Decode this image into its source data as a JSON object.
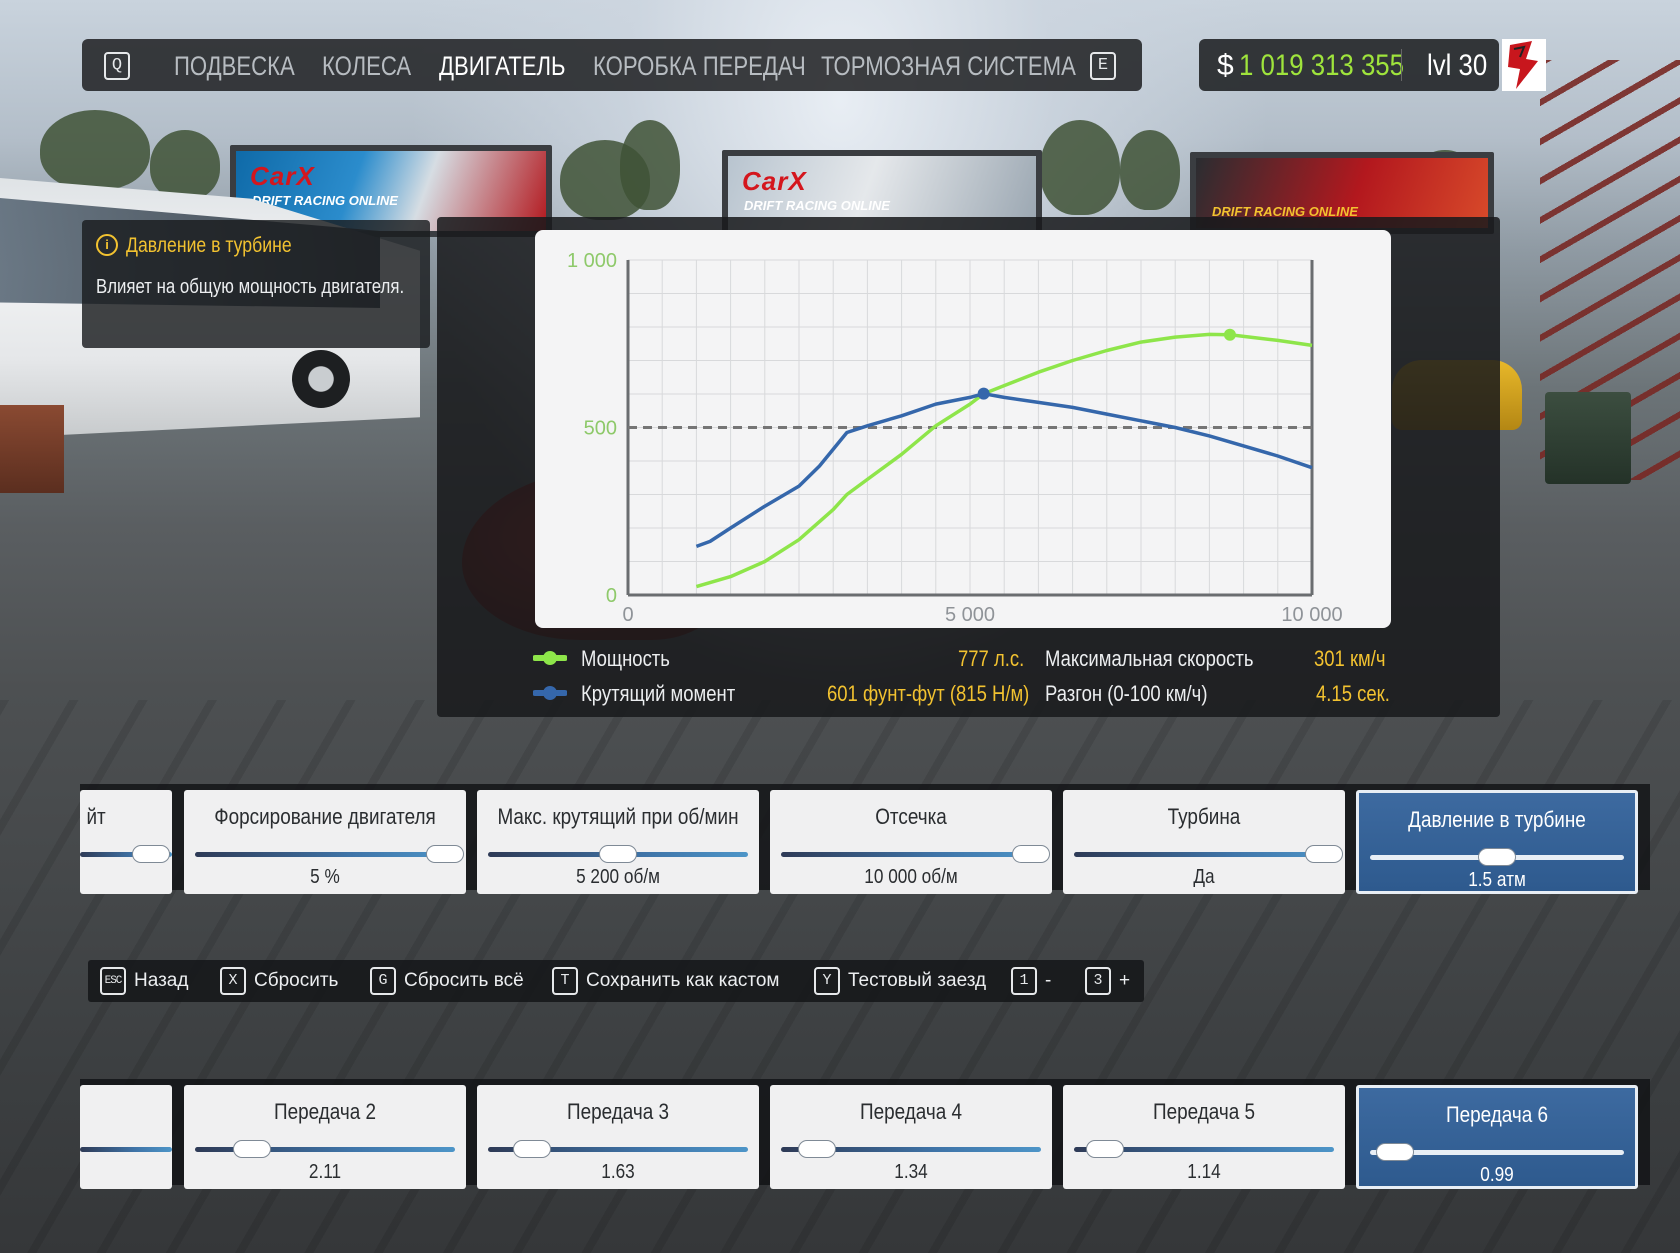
{
  "tabs": {
    "prev_key": "Q",
    "next_key": "E",
    "items": [
      {
        "label": "ПОДВЕСКА",
        "active": false
      },
      {
        "label": "КОЛЕСА",
        "active": false
      },
      {
        "label": "ДВИГАТЕЛЬ",
        "active": true
      },
      {
        "label": "КОРОБКА ПЕРЕДАЧ",
        "active": false
      },
      {
        "label": "ТОРМОЗНАЯ СИСТЕМА",
        "active": false
      }
    ]
  },
  "player": {
    "currency": "$",
    "money": "1 019 313 355",
    "level": "lvl 30"
  },
  "info": {
    "icon": "info-icon",
    "title": "Давление в турбине",
    "text": "Влияет на общую мощность двигателя."
  },
  "chart_data": {
    "type": "line",
    "x_ticks": [
      "0",
      "5 000",
      "10 000"
    ],
    "y_ticks": [
      "0",
      "500",
      "1 000"
    ],
    "xlim": [
      0,
      10000
    ],
    "ylim": [
      0,
      1000
    ],
    "grid": true,
    "reference_line": 500,
    "series": [
      {
        "name": "Мощность",
        "color": "#8ee54a",
        "x": [
          1000,
          1500,
          2000,
          2500,
          3000,
          3200,
          3500,
          4000,
          4500,
          5000,
          5200,
          5500,
          6000,
          6500,
          7000,
          7500,
          8000,
          8500,
          8800,
          9000,
          9500,
          10000
        ],
        "y": [
          25,
          55,
          100,
          165,
          255,
          300,
          345,
          420,
          505,
          570,
          601,
          625,
          665,
          700,
          730,
          755,
          770,
          778,
          777,
          772,
          760,
          745
        ],
        "marker": {
          "x": 8800,
          "y": 777
        }
      },
      {
        "name": "Крутящий момент",
        "color": "#3567ab",
        "x": [
          1000,
          1200,
          1500,
          2000,
          2500,
          2800,
          3200,
          3500,
          4000,
          4500,
          5000,
          5200,
          5500,
          6000,
          6500,
          7000,
          7500,
          8000,
          8500,
          9000,
          9500,
          10000
        ],
        "y": [
          145,
          160,
          200,
          265,
          325,
          385,
          485,
          505,
          535,
          570,
          590,
          601,
          590,
          575,
          560,
          540,
          520,
          500,
          475,
          445,
          415,
          380
        ],
        "marker": {
          "x": 5200,
          "y": 601
        }
      }
    ]
  },
  "stats": {
    "power_label": "Мощность",
    "power_value": "777 л.с.",
    "torque_label": "Крутящий момент",
    "torque_value": "601 фунт-фут (815 Н/м)",
    "speed_label": "Максимальная скорость",
    "speed_value": "301 км/ч",
    "accel_label": "Разгон (0-100 км/ч)",
    "accel_value": "4.15 сек."
  },
  "engine_params": [
    {
      "label": "йт",
      "value": "",
      "level": 0.95,
      "partial": true,
      "active": false
    },
    {
      "label": "Форсирование двигателя",
      "value": "5 %",
      "level": 1.0,
      "partial": false,
      "active": false
    },
    {
      "label": "Макс. крутящий при об/мин",
      "value": "5 200 об/м",
      "level": 0.5,
      "partial": false,
      "active": false
    },
    {
      "label": "Отсечка",
      "value": "10 000 об/м",
      "level": 1.0,
      "partial": false,
      "active": false
    },
    {
      "label": "Турбина",
      "value": "Да",
      "level": 1.0,
      "partial": false,
      "active": false
    },
    {
      "label": "Давление в турбине",
      "value": "1.5 атм",
      "level": 0.5,
      "partial": false,
      "active": true
    }
  ],
  "hotkeys": [
    {
      "key": "ESC",
      "label": "Назад"
    },
    {
      "key": "X",
      "label": "Сбросить"
    },
    {
      "key": "G",
      "label": "Сбросить всё"
    },
    {
      "key": "T",
      "label": "Сохранить как кастом"
    },
    {
      "key": "Y",
      "label": "Тестовый заезд"
    },
    {
      "key": "1",
      "label": "-"
    },
    {
      "key": "3",
      "label": "+"
    }
  ],
  "gear_params": [
    {
      "label": "",
      "value": "",
      "level": 1.0,
      "partial": true,
      "active": false
    },
    {
      "label": "Передача 2",
      "value": "2.11",
      "level": 0.22,
      "partial": false,
      "active": false
    },
    {
      "label": "Передача 3",
      "value": "1.63",
      "level": 0.17,
      "partial": false,
      "active": false
    },
    {
      "label": "Передача 4",
      "value": "1.34",
      "level": 0.14,
      "partial": false,
      "active": false
    },
    {
      "label": "Передача 5",
      "value": "1.14",
      "level": 0.12,
      "partial": false,
      "active": false
    },
    {
      "label": "Передача 6",
      "value": "0.99",
      "level": 0.1,
      "partial": false,
      "active": true
    }
  ]
}
